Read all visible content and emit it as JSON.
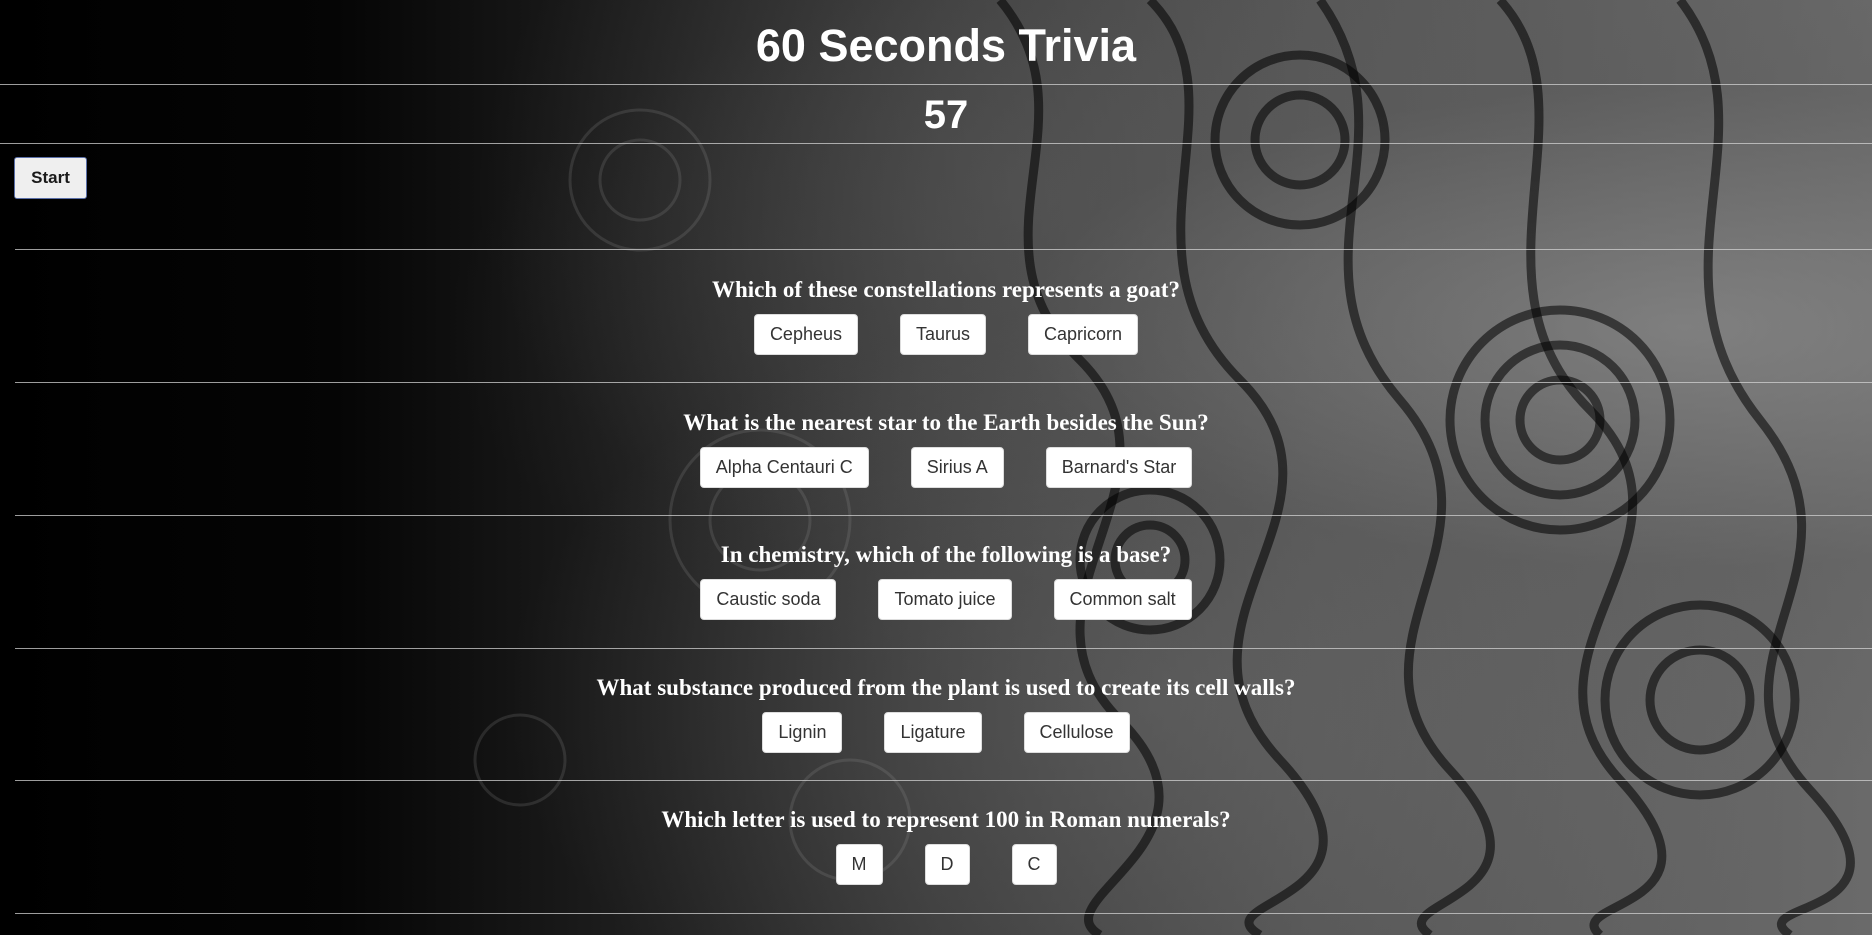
{
  "app": {
    "title": "60 Seconds Trivia",
    "timer": "57",
    "start_label": "Start"
  },
  "questions": [
    {
      "text": "Which of these constellations represents a goat?",
      "answers": [
        "Cepheus",
        "Taurus",
        "Capricorn"
      ]
    },
    {
      "text": "What is the nearest star to the Earth besides the Sun?",
      "answers": [
        "Alpha Centauri C",
        "Sirius A",
        "Barnard's Star"
      ]
    },
    {
      "text": "In chemistry, which of the following is a base?",
      "answers": [
        "Caustic soda",
        "Tomato juice",
        "Common salt"
      ]
    },
    {
      "text": "What substance produced from the plant is used to create its cell walls?",
      "answers": [
        "Lignin",
        "Ligature",
        "Cellulose"
      ]
    },
    {
      "text": "Which letter is used to represent 100 in Roman numerals?",
      "answers": [
        "M",
        "D",
        "C"
      ]
    }
  ],
  "colors": {
    "background": "#000000",
    "text": "#ffffff",
    "answer_button_bg": "#ffffff",
    "answer_button_text": "#333333"
  }
}
